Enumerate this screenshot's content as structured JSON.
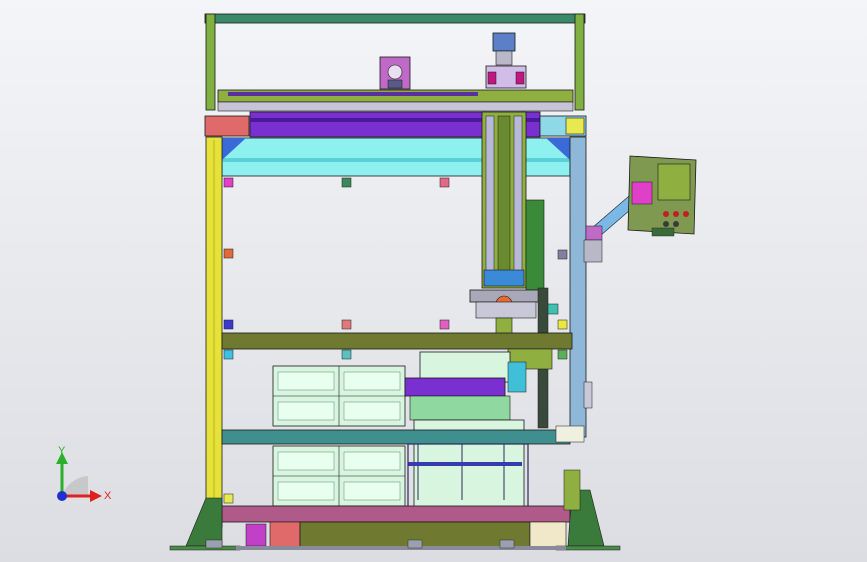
{
  "viewport": {
    "background_top": "#f4f5f8",
    "background_bottom": "#dcdde2"
  },
  "triad": {
    "x_label": "X",
    "y_label": "Y",
    "x_color": "#e02020",
    "y_color": "#2cb02c",
    "z_color": "#2030d0"
  },
  "colors": {
    "frame_green": "#8fb040",
    "frame_yellow": "#e6e23a",
    "cyan_beam": "#8ff0f0",
    "purple_beam": "#7a2fd0",
    "olive_base": "#6f7a30",
    "teal_rail": "#3f8f8f",
    "panel_mint": "#d8f5e0",
    "control_box": "#7f9a50",
    "outline": "#1a1a1a"
  },
  "icons": [
    "triad-icon",
    "servo-motor-icon",
    "control-panel-icon"
  ]
}
